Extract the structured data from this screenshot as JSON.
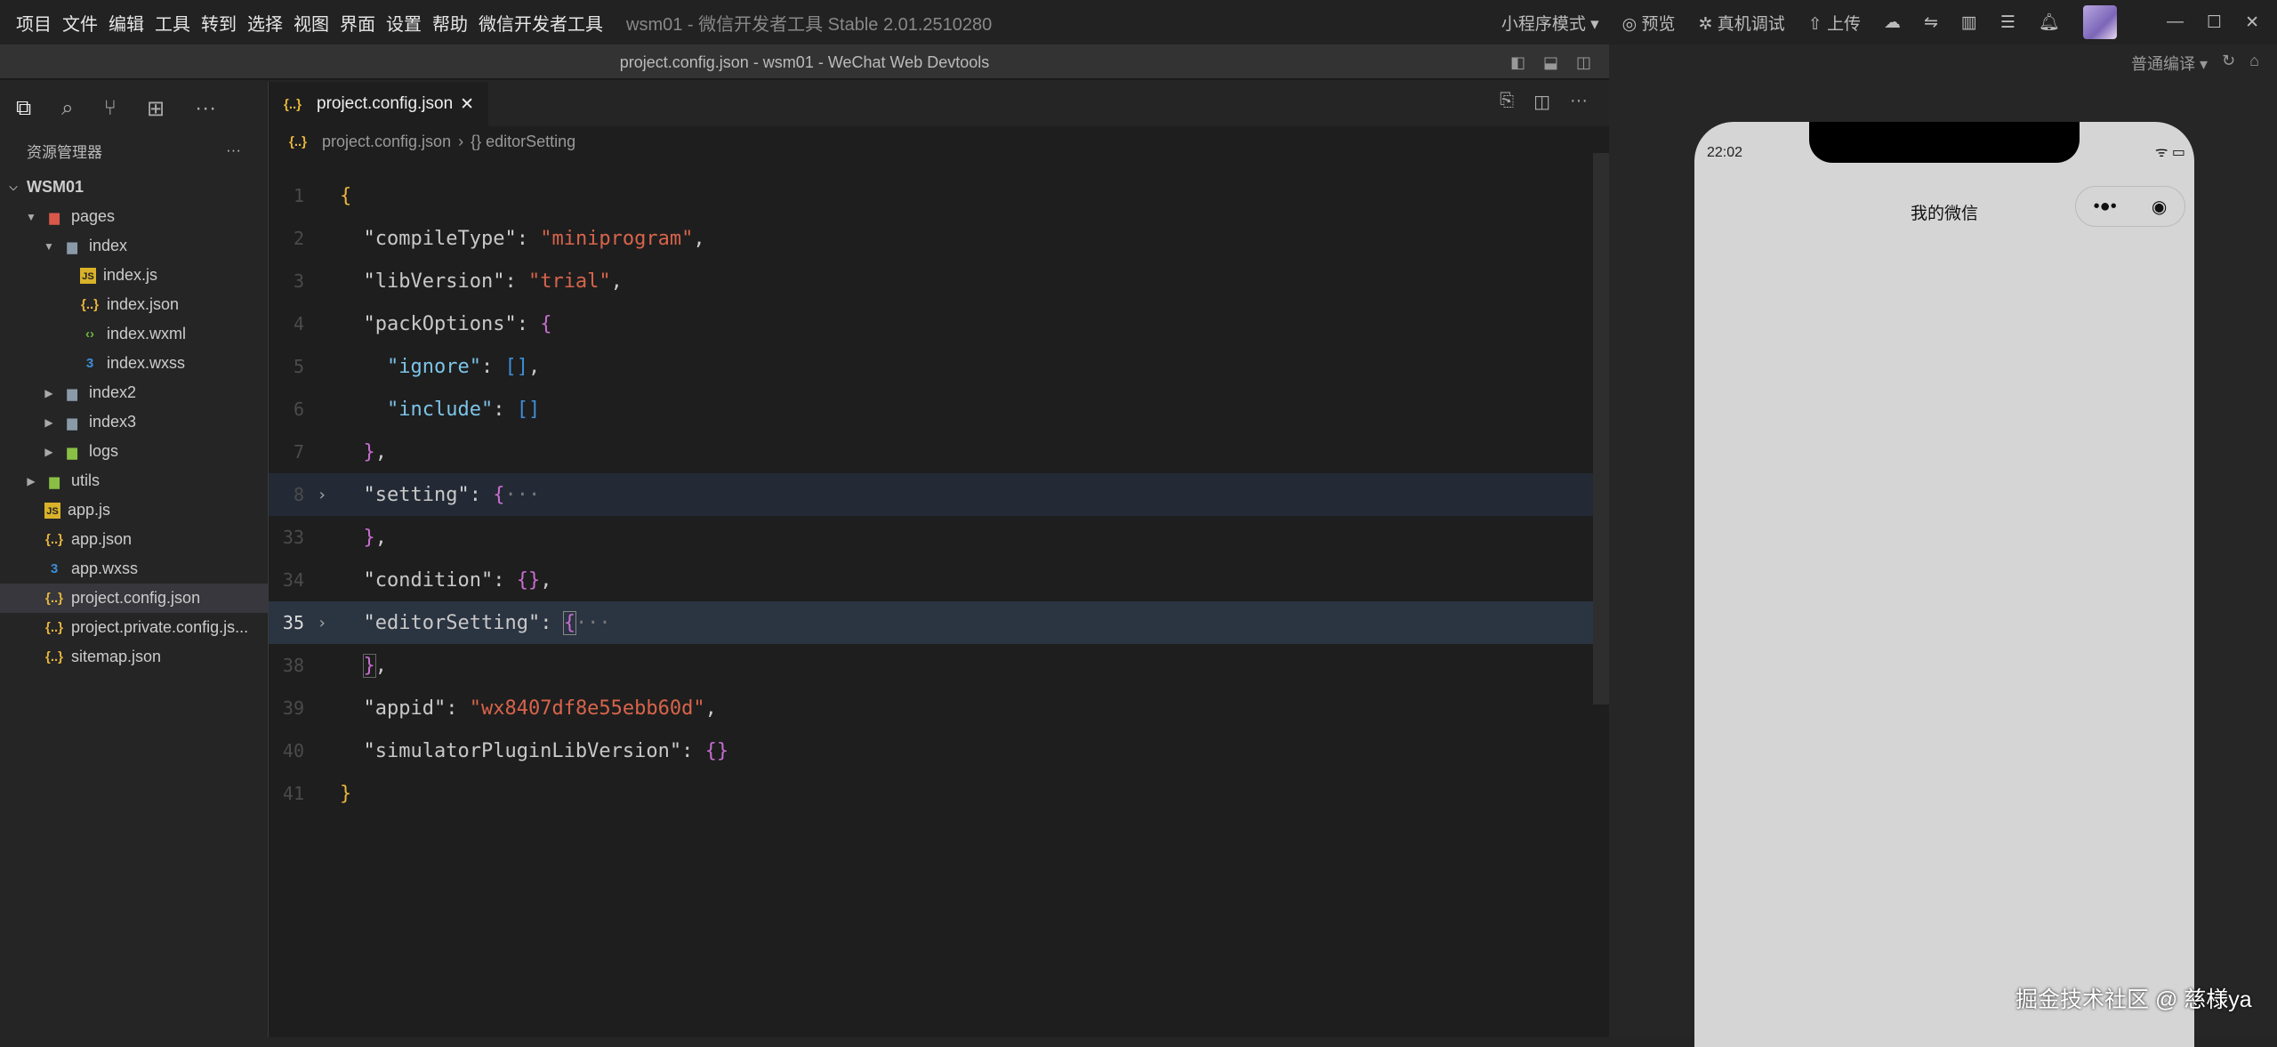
{
  "menu": [
    "项目",
    "文件",
    "编辑",
    "工具",
    "转到",
    "选择",
    "视图",
    "界面",
    "设置",
    "帮助",
    "微信开发者工具"
  ],
  "app_title": "wsm01 - 微信开发者工具 Stable 2.01.2510280",
  "toolbar": {
    "mode": "小程序模式 ▾",
    "preview": "预览",
    "debug": "真机调试",
    "upload": "上传"
  },
  "window_title": "project.config.json - wsm01 - WeChat Web Devtools",
  "sidebar": {
    "title": "资源管理器",
    "root": "WSM01",
    "items": [
      {
        "label": "pages",
        "type": "pages",
        "depth": 1,
        "arrow": "▼"
      },
      {
        "label": "index",
        "type": "folder",
        "depth": 2,
        "arrow": "▼"
      },
      {
        "label": "index.js",
        "type": "js",
        "depth": 3,
        "arrow": ""
      },
      {
        "label": "index.json",
        "type": "json",
        "depth": 3,
        "arrow": ""
      },
      {
        "label": "index.wxml",
        "type": "wxml",
        "depth": 3,
        "arrow": ""
      },
      {
        "label": "index.wxss",
        "type": "wxss",
        "depth": 3,
        "arrow": ""
      },
      {
        "label": "index2",
        "type": "folder",
        "depth": 2,
        "arrow": "▶"
      },
      {
        "label": "index3",
        "type": "folder",
        "depth": 2,
        "arrow": "▶"
      },
      {
        "label": "logs",
        "type": "green",
        "depth": 2,
        "arrow": "▶"
      },
      {
        "label": "utils",
        "type": "green",
        "depth": 1,
        "arrow": "▶"
      },
      {
        "label": "app.js",
        "type": "js",
        "depth": 1,
        "arrow": ""
      },
      {
        "label": "app.json",
        "type": "json",
        "depth": 1,
        "arrow": ""
      },
      {
        "label": "app.wxss",
        "type": "wxss",
        "depth": 1,
        "arrow": ""
      },
      {
        "label": "project.config.json",
        "type": "json",
        "depth": 1,
        "arrow": "",
        "selected": true
      },
      {
        "label": "project.private.config.js...",
        "type": "json",
        "depth": 1,
        "arrow": ""
      },
      {
        "label": "sitemap.json",
        "type": "json",
        "depth": 1,
        "arrow": ""
      }
    ]
  },
  "editor": {
    "tab": "project.config.json",
    "breadcrumb_file": "project.config.json",
    "breadcrumb_symbol": "{} editorSetting",
    "lines": [
      {
        "n": "1",
        "html": "<span class='b1'>{</span>"
      },
      {
        "n": "2",
        "html": "  <span class='q'>\"</span><span class='k'>compileType</span><span class='q'>\"</span>: <span class='s'>\"miniprogram\"</span>,"
      },
      {
        "n": "3",
        "html": "  <span class='q'>\"</span><span class='k'>libVersion</span><span class='q'>\"</span>: <span class='s'>\"trial\"</span>,"
      },
      {
        "n": "4",
        "html": "  <span class='q'>\"</span><span class='k'>packOptions</span><span class='q'>\"</span>: <span class='b2'>{</span>"
      },
      {
        "n": "5",
        "html": "    <span class='kc'>\"ignore\"</span>: <span class='b3'>[]</span>,"
      },
      {
        "n": "6",
        "html": "    <span class='kc'>\"include\"</span>: <span class='b3'>[]</span>"
      },
      {
        "n": "7",
        "html": "  <span class='b2'>}</span>,"
      },
      {
        "n": "8",
        "html": "  <span class='q'>\"</span><span class='k'>setting</span><span class='q'>\"</span>: <span class='b2'>{</span><span class='dim'>···</span>",
        "fold": true,
        "cls": "hl"
      },
      {
        "n": "33",
        "html": "  <span class='b2'>}</span>,"
      },
      {
        "n": "34",
        "html": "  <span class='q'>\"</span><span class='k'>condition</span><span class='q'>\"</span>: <span class='b2'>{}</span>,"
      },
      {
        "n": "35",
        "html": "  <span class='q'>\"</span><span class='k'>editorSetting</span><span class='q'>\"</span>: <span class='b2' style='outline:1px solid #888'>{</span><span class='dim'>···</span>",
        "fold": true,
        "cls": "hl2",
        "cur": true
      },
      {
        "n": "38",
        "html": "  <span class='b2' style='outline:1px solid #666'>}</span>,"
      },
      {
        "n": "39",
        "html": "  <span class='q'>\"</span><span class='k'>appid</span><span class='q'>\"</span>: <span class='s'>\"wx8407df8e55ebb60d\"</span>,"
      },
      {
        "n": "40",
        "html": "  <span class='q'>\"</span><span class='k'>simulatorPluginLibVersion</span><span class='q'>\"</span>: <span class='b2'>{}</span>"
      },
      {
        "n": "41",
        "html": "<span class='b1'>}</span>"
      }
    ]
  },
  "simulator": {
    "compile": "普通编译 ▾",
    "time": "22:02",
    "nav_title": "我的微信"
  },
  "watermark": "掘金技术社区 @ 慈様ya"
}
